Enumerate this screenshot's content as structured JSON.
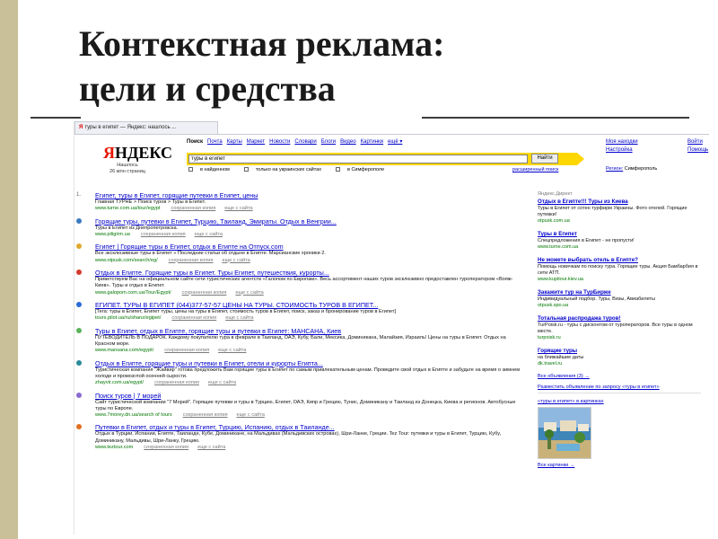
{
  "slide": {
    "title_line1": "Контекстная реклама:",
    "title_line2": "цели и средства"
  },
  "browser": {
    "tab_title": "туры в египет — Яндекс: нашлось ..."
  },
  "yandex": {
    "logo_first": "Я",
    "logo_rest": "НДЕКС",
    "tagline": "Нашлось\n26 млн страниц",
    "nav": [
      "Поиск",
      "Почта",
      "Карты",
      "Маркет",
      "Новости",
      "Словари",
      "Блоги",
      "Видео",
      "Картинки",
      "ещё ▾"
    ],
    "search_value": "туры в египет",
    "search_button": "Найти",
    "filters": [
      "в найденном",
      "только на украинских сайтах",
      "в Симферополе"
    ],
    "advanced_link": "расширенный поиск",
    "user_links": [
      "Моя находки",
      "Настройка"
    ],
    "far_links": [
      "Войти",
      "Помощь"
    ],
    "region_label": "Регион:",
    "region_value": "Симферополь"
  },
  "results": [
    {
      "num": "1.",
      "title": "Египет, туры в Египет, горящие путевки в Египет, цены",
      "snippet": "Главная ТУРНЕ > Поиск туров > Туры в Египет.",
      "url": "www.turne.com.ua/tour/egypt",
      "cache": "сохраненная копия",
      "more": "еще с сайта"
    },
    {
      "num": "2.",
      "title": "Горящие туры, путевки в Египет, Турцию, Таиланд, Эмираты. Отдых в Венгрии...",
      "snippet": "Туры в Египет из Днепропетровска.",
      "url": "www.piligrim.ua",
      "cache": "сохраненная копия",
      "more": "еще с сайта"
    },
    {
      "num": "3.",
      "title": "Египет | Горящие туры в Египет, отдых в Египте на Отпуск.com",
      "snippet": "Все эксклюзивные туры в Египет » Последние статьи об отдыхе в Египте. Марсианские хроники 2.",
      "url": "www.otpusk.com/search/eg/",
      "cache": "сохраненная копия",
      "more": "еще с сайта"
    },
    {
      "num": "4.",
      "title": "Отдых в Египте. Горящие туры в Египет. Туры Египет, путешествия, курорты...",
      "snippet": "Приветствуем Вас на официальном сайте сети туристических агентств «Галопом по Европам». Весь ассортимент наших туров эксклюзивно предоставлен туроператором «Вояж-Киев». Туры и отдых в Египет.",
      "url": "www.galopom.com.ua/Tour/Egypt/",
      "cache": "сохраненная копия",
      "more": "еще с сайта"
    },
    {
      "num": "5.",
      "title": "ЕГИПЕТ. ТУРЫ В ЕГИПЕТ (044)377-57-57 ЦЕНЫ НА ТУРЫ. СТОИМОСТЬ ТУРОВ В ЕГИПЕТ...",
      "snippet": "[Тега: туры в Египет, Египет туры, цены на туры в Египет, стоимость туров в Египет, поиск, заказ и бронирование туров в Египет]",
      "url": "tours.pilot.ua/ru/shanz/egipet/",
      "cache": "сохраненная копия",
      "more": "еще с сайта"
    },
    {
      "num": "6.",
      "title": "Туры в Египет, отдых в Египте, горящие туры и путевки в Египет: МАНСАНА, Киев",
      "snippet": "ПУТЕВОДИТЕЛЬ В ПОДАРОК. Каждому покупателю тура в феврале в Таиланд, ОАЭ, Кубу, Бали, Мексика, Доминикана, Малайзия, Израиль! Цены на туры в Египет. Отдых на Красном море.",
      "url": "www.mansana.com/egypt/",
      "cache": "сохраненная копия",
      "more": "еще с сайта"
    },
    {
      "num": "7.",
      "title": "Отдых в Египте, горящие туры и путевки в Египет, отели и курорты Египта...",
      "snippet": "Туристическая компания \"Жайвир\" готова предложить Вам горящие туры в Египет по самым привлекательным ценам. Проведите свой отдых в Египте и забудьте на время о зимнем холоде и промозглой осенней сырости.",
      "url": "zhayvir.com.ua/egypt/",
      "cache": "сохраненная копия",
      "more": "еще с сайта"
    },
    {
      "num": "8.",
      "title": "Поиск туров | 7 морей",
      "snippet": "Сайт туристической компании \"7 Морей\". Горящие путевки и туры в Турцию, Египет, ОАЭ, Кипр и Грецию, Тунис, Доминикану и Таиланд из Донецка, Киева и регионов. Автобусные туры по Европе.",
      "url": "www.7morey.dn.ua/search of tours",
      "cache": "сохраненная копия",
      "more": "еще с сайта"
    },
    {
      "num": "9.",
      "title": "Путевки в Египет, отдых и туры в Египет, Турцию, Испанию, отдых в Таиланде...",
      "snippet": "Отдых в Турции, Испании, Египте, Таиланде, Кубе, Доминикане, на Мальдивах (Мальдивских островах), Шри-Ланке, Греции. Tez Tour: путевки и туры в Египет, Турцию, Кубу, Доминикану, Мальдивы, Шри-Ланку, Грецию.",
      "url": "www.teztour.com",
      "cache": "сохраненная копия",
      "more": "еще с сайта"
    }
  ],
  "ads": {
    "header": "Яндекс.Директ",
    "items": [
      {
        "title": "Отдых в Египте!!! Туры из Киева",
        "text": "Туры в Египет от сотен турфирм Украины. Фото отелей. Горящие путевки!",
        "url": "otpusk.com.ua"
      },
      {
        "title": "Туры в Египет",
        "text": "Спецпредложения в Египет - не пропусти!",
        "url": "www.turne.com.ua"
      },
      {
        "title": "Не можете выбрать отель в Египте?",
        "text": "Помощь новичкам по поиску тура. Горящие туры. Акция Бамбарбия в сети АТП.",
        "url": "www.kupitour.kiev.ua"
      },
      {
        "title": "Закажите тур на ТурБиржe",
        "text": "Индивидуальный подбор. Туры, Визы, Авиабилеты",
        "url": "otpusk.spo.ua"
      },
      {
        "title": "Тотальная распродажа туров!",
        "text": "TurPoisk.ru - туры с дисконтом от туроператоров. Все туры в одном месте.",
        "url": "turpoisk.ru"
      },
      {
        "title": "Горящие туры",
        "text": "на ближайшие даты",
        "url": "dk.travel.ru"
      }
    ],
    "all_ads": "Все объявления (3) →",
    "place_link": "Разместить объявление по запросу «туры в египет»",
    "images_head": "«туры в египет» в картинках",
    "all_images": "Все картинки →"
  },
  "colors": {
    "link": "#0000cc",
    "url": "#007700",
    "search_bar": "#ffd700",
    "logo_red": "#e61400",
    "slide_band": "#c9bf99"
  }
}
